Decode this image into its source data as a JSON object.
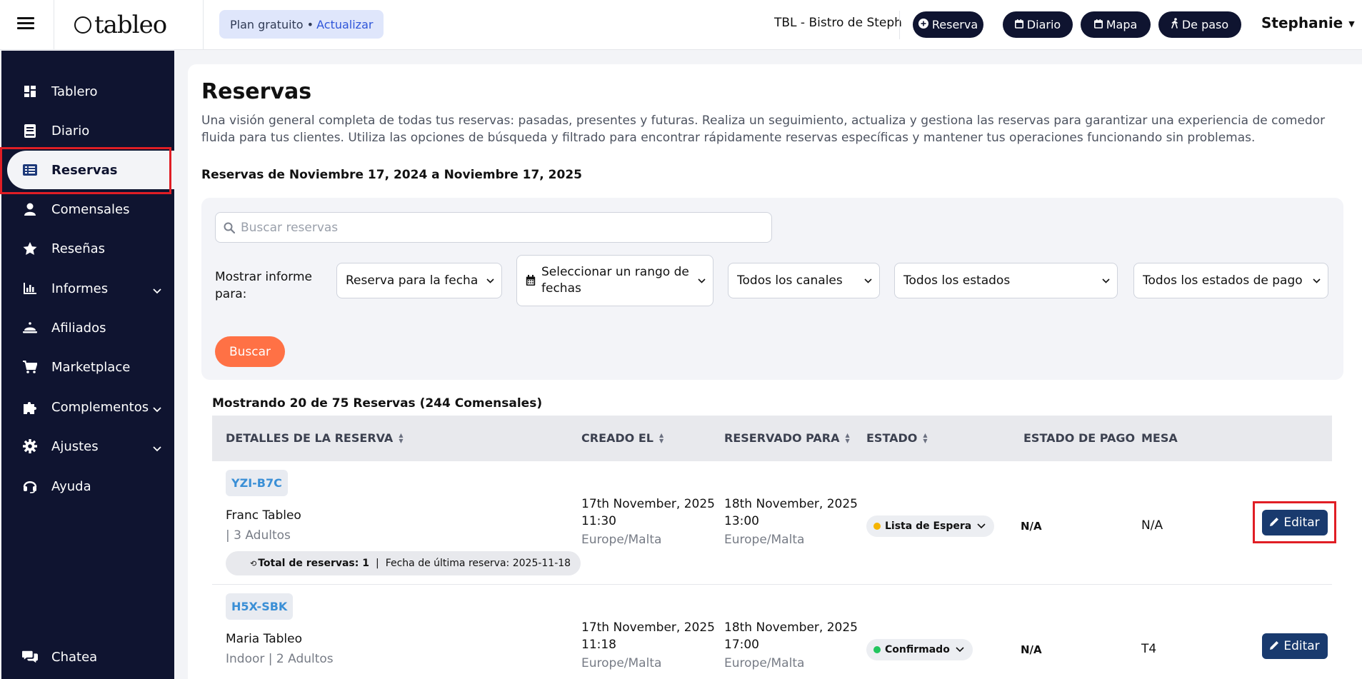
{
  "topbar": {
    "logo_text": "tableo",
    "plan_label": "Plan gratuito •",
    "upgrade_label": "Actualizar",
    "venue": "TBL - Bistro de Steph",
    "buttons": [
      {
        "label": "Reserva",
        "icon": "plus-circle-icon"
      },
      {
        "label": "Diario",
        "icon": "calendar-icon"
      },
      {
        "label": "Mapa",
        "icon": "calendar-icon"
      },
      {
        "label": "De paso",
        "icon": "walking-icon"
      }
    ],
    "user": "Stephanie"
  },
  "sidebar": {
    "items": [
      {
        "label": "Tablero",
        "icon": "dashboard-icon"
      },
      {
        "label": "Diario",
        "icon": "book-icon"
      },
      {
        "label": "Reservas",
        "icon": "list-icon",
        "active": true
      },
      {
        "label": "Comensales",
        "icon": "user-icon"
      },
      {
        "label": "Reseñas",
        "icon": "star-icon"
      },
      {
        "label": "Informes",
        "icon": "chart-icon",
        "expandable": true
      },
      {
        "label": "Afiliados",
        "icon": "bell-icon"
      },
      {
        "label": "Marketplace",
        "icon": "cart-icon"
      },
      {
        "label": "Complementos",
        "icon": "puzzle-icon",
        "expandable": true
      },
      {
        "label": "Ajustes",
        "icon": "gear-icon",
        "expandable": true
      },
      {
        "label": "Ayuda",
        "icon": "headset-icon"
      }
    ],
    "chat_label": "Chatea"
  },
  "main": {
    "title": "Reservas",
    "description": "Una visión general completa de todas tus reservas: pasadas, presentes y futuras. Realiza un seguimiento, actualiza y gestiona las reservas para garantizar una experiencia de comedor fluida para tus clientes. Utiliza las opciones de búsqueda y filtrado para encontrar rápidamente reservas específicas y mantener tus operaciones funcionando sin problemas.",
    "date_range": "Reservas de Noviembre 17, 2024 a Noviembre 17, 2025",
    "search_placeholder": "Buscar reservas",
    "show_report_label": "Mostrar informe para:",
    "filters": {
      "date_type": "Reserva para la fecha",
      "date_range": "Seleccionar un rango de fechas",
      "channels": "Todos los canales",
      "statuses": "Todos los estados",
      "payment_statuses": "Todos los estados de pago"
    },
    "search_button": "Buscar",
    "showing": "Mostrando 20 de 75 Reservas (244 Comensales)"
  },
  "table": {
    "headers": {
      "details": "DETALLES DE LA RESERVA",
      "created": "CREADO EL",
      "reserved_for": "RESERVADO PARA",
      "status": "ESTADO",
      "payment_status": "ESTADO DE PAGO",
      "table": "MESA"
    },
    "edit_label": "Editar",
    "rows": [
      {
        "code": "YZI-B7C",
        "guest": "Franc Tableo",
        "party": "| 3 Adultos",
        "total_label": "Total de reservas: 1",
        "last_label": "Fecha de última reserva: 2025-11-18",
        "created_date": "17th November, 2025",
        "created_time": "11:30",
        "created_tz": "Europe/Malta",
        "reserved_date": "18th November, 2025",
        "reserved_time": "13:00",
        "reserved_tz": "Europe/Malta",
        "status": "Lista de Espera",
        "status_color": "#f5b400",
        "payment": "N/A",
        "table": "N/A"
      },
      {
        "code": "H5X-SBK",
        "guest": "Maria Tableo",
        "party": "Indoor | 2 Adultos",
        "created_date": "17th November, 2025",
        "created_time": "11:18",
        "created_tz": "Europe/Malta",
        "reserved_date": "18th November, 2025",
        "reserved_time": "17:00",
        "reserved_tz": "Europe/Malta",
        "status": "Confirmado",
        "status_color": "#22c55e",
        "payment": "N/A",
        "table": "T4"
      }
    ]
  },
  "colors": {
    "sidebar_bg": "#0f1430",
    "accent_orange": "#ff7145",
    "edit_button": "#193a6e",
    "highlight_red": "#e01e25"
  }
}
